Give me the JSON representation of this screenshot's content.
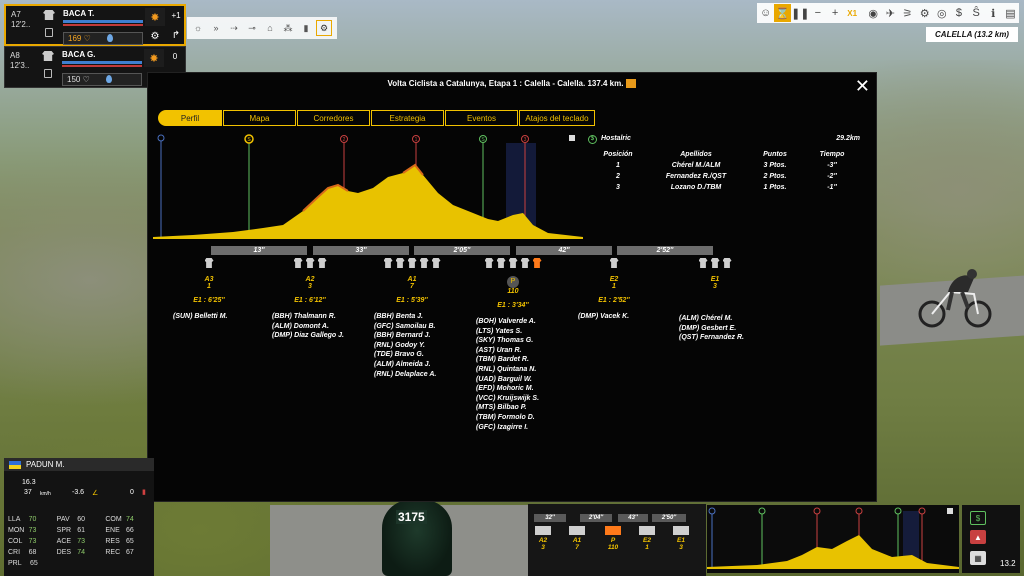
{
  "colors": {
    "accent": "#f2c200",
    "profile_fill": "#e8c200",
    "sprint": "#5fc05f",
    "climb": "#c84040"
  },
  "riders": [
    {
      "pos": "A7",
      "time": "12'2..",
      "name": "BACA T.",
      "energy": "169",
      "side_top": "+1",
      "side_num": "",
      "selected": true
    },
    {
      "pos": "A8",
      "time": "12'3..",
      "name": "BACA G.",
      "energy": "150",
      "side_top": "0",
      "side_num": "",
      "selected": false
    }
  ],
  "top_toolbar": {
    "speed": "X1",
    "place_label": "CALELLA (13.2 km)"
  },
  "modal": {
    "title": "Volta Ciclista a Catalunya, Etapa 1 : Calella - Calella. 137.4 km.",
    "tabs": [
      "Perfil",
      "Mapa",
      "Corredores",
      "Estrategia",
      "Eventos",
      "Atajos del teclado"
    ],
    "markers": [
      "S",
      "2",
      "1",
      "S",
      "3"
    ],
    "segments": [
      {
        "label": "13''"
      },
      {
        "label": "33''"
      },
      {
        "label": "2'05''"
      },
      {
        "label": "42''"
      },
      {
        "label": "2'52''"
      }
    ],
    "groups": [
      {
        "cat": "A3",
        "count": "1",
        "gap": "E1 : 6'25''",
        "names": [
          "(SUN) Belletti M."
        ]
      },
      {
        "cat": "A2",
        "count": "3",
        "gap": "E1 : 6'12''",
        "names": [
          "(BBH) Thalmann R.",
          "(ALM) Domont A.",
          "(DMP) Diaz Gallego J."
        ]
      },
      {
        "cat": "A1",
        "count": "7",
        "gap": "E1 : 5'39''",
        "names": [
          "(BBH) Benta J.",
          "(GFC) Samoilau B.",
          "(BBH) Bernard J.",
          "(RNL) Godoy Y.",
          "(TDE) Bravo G.",
          "(ALM) Almeida J.",
          "(RNL) Delaplace A."
        ]
      },
      {
        "cat": "P",
        "count": "110",
        "gap": "E1 : 3'34''",
        "names": [
          "(BOH) Valverde A.",
          "(LTS) Yates S.",
          "(SKY) Thomas G.",
          "(AST) Uran R.",
          "(TBM) Bardet R.",
          "(RNL) Quintana N.",
          "(UAD) Barguil W.",
          "(EFD) Mohoric M.",
          "(VCC) Kruijswijk S.",
          "(MTS) Bilbao P.",
          "(TBM) Formolo D.",
          "(GFC) Izagirre I."
        ]
      },
      {
        "cat": "E2",
        "count": "1",
        "gap": "E1 : 2'52''",
        "names": [
          "(DMP) Vacek K."
        ]
      },
      {
        "cat": "E1",
        "count": "3",
        "gap": "",
        "names": [
          "(ALM) Chérel M.",
          "(DMP) Gesbert E.",
          "(QST) Fernandez R."
        ]
      }
    ],
    "results": {
      "place": "Hostalric",
      "distance": "29.2km",
      "headers": [
        "Posición",
        "Apellidos",
        "Puntos",
        "Tiempo"
      ],
      "rows": [
        [
          "1",
          "Chérel M./ALM",
          "3 Ptos.",
          "-3''"
        ],
        [
          "2",
          "Fernandez R./QST",
          "2 Ptos.",
          "-2''"
        ],
        [
          "3",
          "Lozano D./TBM",
          "1 Ptos.",
          "-1''"
        ]
      ]
    }
  },
  "stats": {
    "name": "PADUN M.",
    "speed": "16.3",
    "kmh": "37",
    "kmh_unit": "km/h",
    "slope": "-3.6",
    "zero": "0",
    "grid": [
      [
        "LLA",
        "70",
        "PAV",
        "60",
        "COM",
        "74"
      ],
      [
        "MON",
        "73",
        "SPR",
        "61",
        "ENE",
        "66"
      ],
      [
        "COL",
        "73",
        "ACE",
        "73",
        "RES",
        "65"
      ],
      [
        "CRI",
        "68",
        "DES",
        "74",
        "REC",
        "67"
      ],
      [
        "PRL",
        "65",
        "",
        "",
        "",
        ""
      ]
    ]
  },
  "mini": {
    "segments": [
      "32''",
      "2'04''",
      "43''",
      "2'50''"
    ],
    "groups": [
      {
        "cat": "A2",
        "count": "3"
      },
      {
        "cat": "A1",
        "count": "7"
      },
      {
        "cat": "P",
        "count": "110"
      },
      {
        "cat": "E2",
        "count": "1"
      },
      {
        "cat": "E1",
        "count": "3"
      }
    ],
    "distance": "13.2"
  },
  "bib": "3175"
}
